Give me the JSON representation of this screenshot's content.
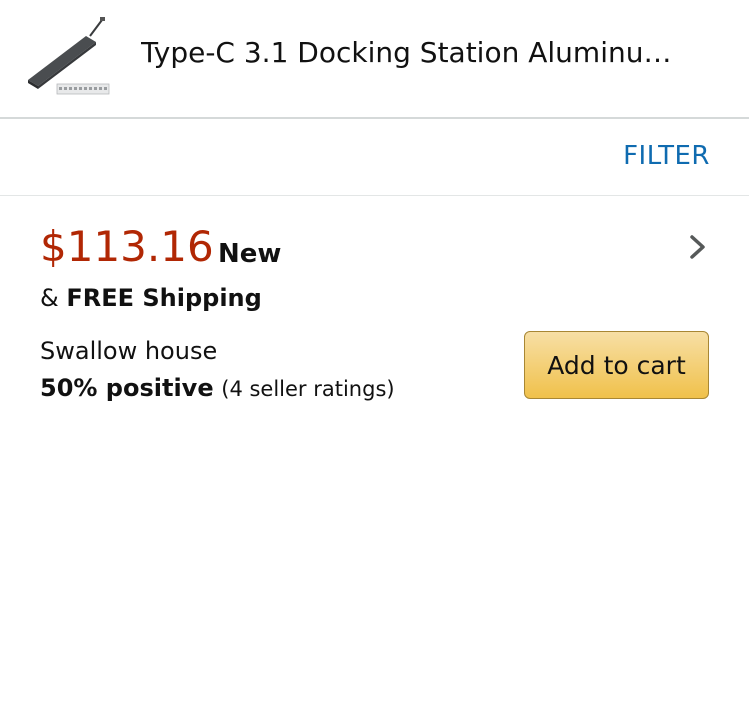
{
  "product": {
    "title": "Type-C 3.1 Docking Station Aluminu…",
    "thumbnail_icon": "docking-station-image"
  },
  "filter": {
    "label": "FILTER",
    "color": "#0f6bb0"
  },
  "offer": {
    "price": "$113.16",
    "price_color": "#b12704",
    "condition": "New",
    "shipping_prefix": "& ",
    "shipping_label": "FREE Shipping",
    "seller_name": "Swallow house",
    "rating_percent": "50% positive",
    "rating_count": "(4 seller ratings)",
    "add_to_cart_label": "Add to cart",
    "details_icon": "chevron-right-icon"
  },
  "colors": {
    "button_top": "#f7dfa5",
    "button_bottom": "#f0c14b",
    "button_border": "#a88734"
  }
}
